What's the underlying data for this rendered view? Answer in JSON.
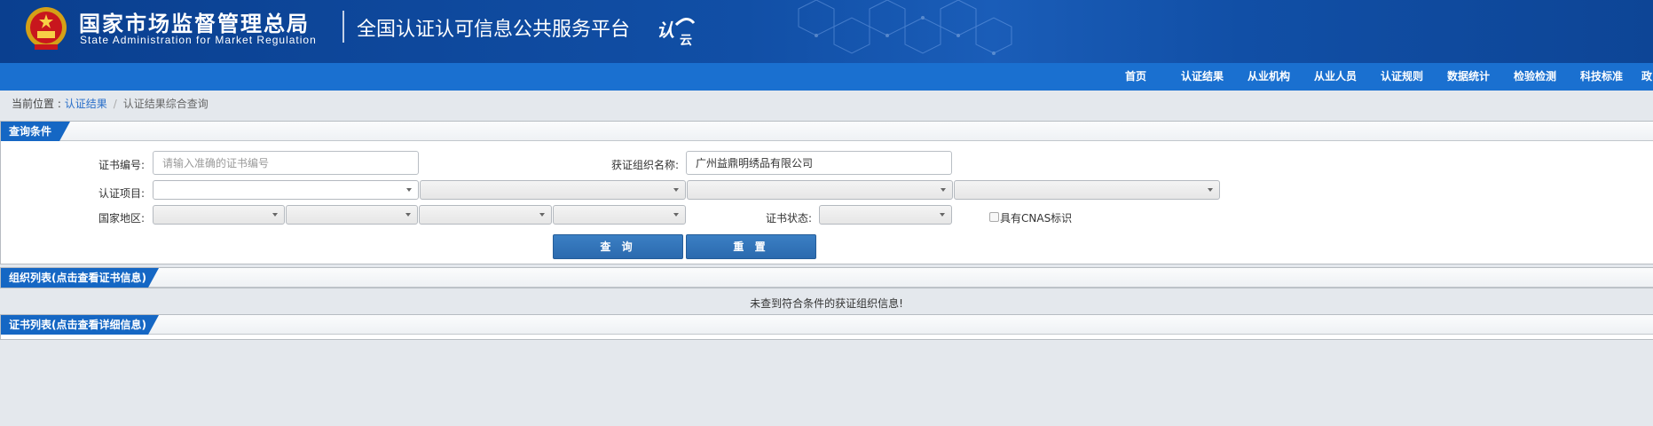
{
  "header": {
    "org_cn": "国家市场监督管理总局",
    "org_en": "State Administration  for  Market Regulation",
    "platform": "全国认证认可信息公共服务平台",
    "brand_logo_text": "认云",
    "colors": {
      "banner": "#114fa6",
      "navbar": "#1a70d0",
      "tab": "#1567c4"
    }
  },
  "nav": {
    "items": [
      "首页",
      "认证结果",
      "从业机构",
      "从业人员",
      "认证规则",
      "数据统计",
      "检验检测",
      "科技标准",
      " 政"
    ]
  },
  "breadcrumb": {
    "prefix": "当前位置 : ",
    "link": "认证结果",
    "separator": "/",
    "current": "认证结果综合查询"
  },
  "query": {
    "title": "查询条件",
    "cert_no_label": "证书编号:",
    "cert_no_placeholder": "请输入准确的证书编号",
    "org_name_label": "获证组织名称:",
    "org_name_value": "广州益鼎明绣品有限公司",
    "cert_item_label": "认证项目:",
    "region_label": "国家地区:",
    "status_label": "证书状态:",
    "cnas_label": "具有CNAS标识",
    "search_button": "查 询",
    "reset_button": "重 置"
  },
  "org_list": {
    "title": "组织列表(点击查看证书信息)",
    "empty_message": "未查到符合条件的获证组织信息!"
  },
  "cert_list": {
    "title": "证书列表(点击查看详细信息)"
  }
}
